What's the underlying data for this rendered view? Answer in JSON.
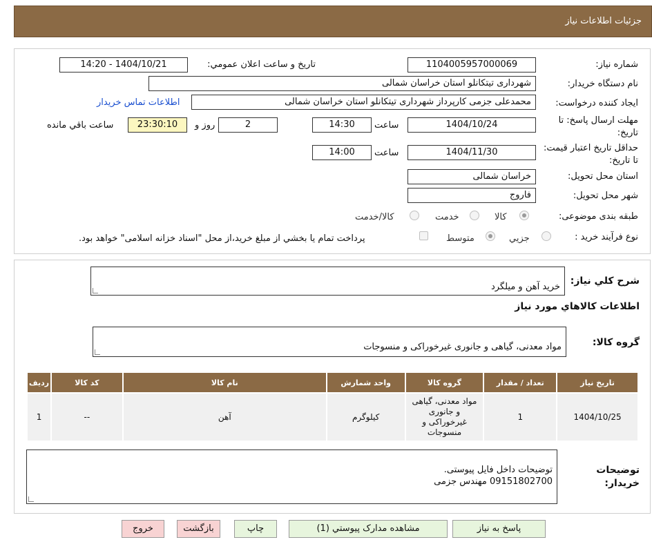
{
  "header": {
    "title": "جزئیات اطلاعات نیاز"
  },
  "form": {
    "need_number_label": "شماره نیاز:",
    "need_number": "1104005957000069",
    "announce_label": "تاریخ و ساعت اعلان عمومي:",
    "announce_value": "1404/10/21 - 14:20",
    "buyer_org_label": "نام دستگاه خريدار:",
    "buyer_org": "شهرداری تیتکانلو استان خراسان شمالی",
    "requester_label": "ایجاد کننده درخواست:",
    "requester": "محمدعلی جزمی کارپرداز شهرداری تیتکانلو استان خراسان شمالی",
    "contact_link": "اطلاعات تماس خريدار",
    "deadline_label": "مهلت ارسال پاسخ: تا تاریخ:",
    "deadline_date": "1404/10/24",
    "time_label": "ساعت",
    "deadline_time": "14:30",
    "days": "2",
    "days_label": "روز و",
    "remaining": "23:30:10",
    "remaining_label": "ساعت باقي مانده",
    "validity_label": "حداقل تاريخ اعتبار قيمت: تا تاريخ:",
    "validity_date": "1404/11/30",
    "validity_time": "14:00",
    "province_label": "استان محل تحويل:",
    "province": "خراسان شمالی",
    "city_label": "شهر محل تحويل:",
    "city": "فاروج",
    "category_label": "طبقه بندی موضوعی:",
    "category_options": [
      "کالا",
      "خدمت",
      "کالا/خدمت"
    ],
    "process_label": "نوع فرآيند خريد :",
    "process_options": [
      "جزيي",
      "متوسط"
    ],
    "payment_note": "پرداخت تمام يا بخشي از مبلغ خريد،از محل \"اسناد خزانه اسلامی\" خواهد بود."
  },
  "summary": {
    "desc_label": "شرح کلي نياز:",
    "desc": "خرید آهن و میلگرد",
    "goods_info_title": "اطلاعات کالاهاي مورد نياز",
    "group_label": "گروه کالا:",
    "group": "مواد معدنی، گیاهی و جانوری غیرخوراکی و منسوجات"
  },
  "table": {
    "headers": [
      "رديف",
      "کد کالا",
      "نام کالا",
      "واحد شمارش",
      "گروه کالا",
      "تعداد / مقدار",
      "تاريخ نياز"
    ],
    "rows": [
      [
        "1",
        "--",
        "آهن",
        "کيلوگرم",
        "مواد معدنی، گیاهی و جانوری غیرخوراکی و منسوجات",
        "1",
        "1404/10/25"
      ]
    ]
  },
  "notes": {
    "label": "توضيحات خريدار:",
    "text": "توضیحات داخل فایل پیوستی.\n09151802700 مهندس جزمی"
  },
  "buttons": {
    "reply": "پاسخ به نياز",
    "attachments": "مشاهده مدارک پيوستي (1)",
    "print": "چاپ",
    "back": "بازگشت",
    "exit": "خروج"
  },
  "colors": {
    "header_bg": "#8b6a45",
    "button_green": "#e7f5dd",
    "button_pink": "#f8d3d3",
    "highlight": "#fcf7c0"
  }
}
